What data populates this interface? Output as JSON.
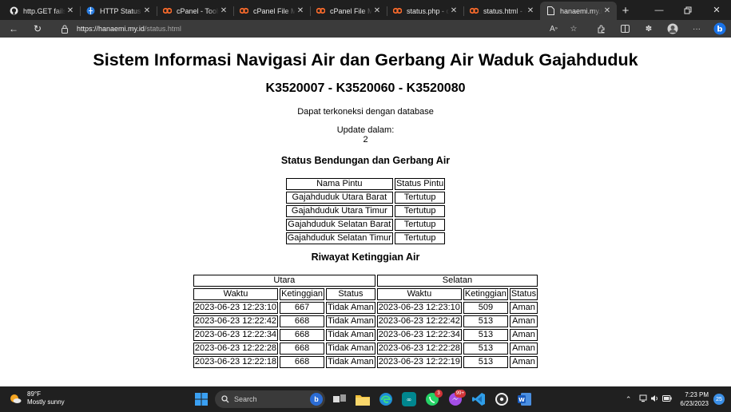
{
  "browser": {
    "tabs": [
      {
        "title": "http.GET fails",
        "icon": "github"
      },
      {
        "title": "HTTP Status C",
        "icon": "globe"
      },
      {
        "title": "cPanel - Tools",
        "icon": "cpanel"
      },
      {
        "title": "cPanel File Ma",
        "icon": "cpanel"
      },
      {
        "title": "cPanel File Ma",
        "icon": "cpanel"
      },
      {
        "title": "status.php - c",
        "icon": "cpanel"
      },
      {
        "title": "status.html - c",
        "icon": "cpanel"
      },
      {
        "title": "hanaemi.my.id",
        "icon": "page",
        "active": true
      }
    ],
    "url_host": "https://hanaemi.my.id",
    "url_path": "/status.html"
  },
  "page": {
    "title": "Sistem Informasi Navigasi Air dan Gerbang Air Waduk Gajahduduk",
    "subtitle": "K3520007 - K3520060 - K3520080",
    "db_status": "Dapat terkoneksi dengan database",
    "update_label": "Update dalam:",
    "update_value": "2",
    "gate_section_title": "Status Bendungan dan Gerbang Air",
    "gate_table": {
      "headers": [
        "Nama Pintu",
        "Status Pintu"
      ],
      "rows": [
        [
          "Gajahduduk Utara Barat",
          "Tertutup"
        ],
        [
          "Gajahduduk Utara Timur",
          "Tertutup"
        ],
        [
          "Gajahduduk Selatan Barat",
          "Tertutup"
        ],
        [
          "Gajahduduk Selatan Timur",
          "Tertutup"
        ]
      ]
    },
    "history_section_title": "Riwayat Ketinggian Air",
    "history_table": {
      "group_headers": [
        "Utara",
        "Selatan"
      ],
      "headers": [
        "Waktu",
        "Ketinggian",
        "Status",
        "Waktu",
        "Ketinggian",
        "Status"
      ],
      "rows": [
        [
          "2023-06-23 12:23:10",
          "667",
          "Tidak Aman",
          "2023-06-23 12:23:10",
          "509",
          "Aman"
        ],
        [
          "2023-06-23 12:22:42",
          "668",
          "Tidak Aman",
          "2023-06-23 12:22:42",
          "513",
          "Aman"
        ],
        [
          "2023-06-23 12:22:34",
          "668",
          "Tidak Aman",
          "2023-06-23 12:22:34",
          "513",
          "Aman"
        ],
        [
          "2023-06-23 12:22:28",
          "668",
          "Tidak Aman",
          "2023-06-23 12:22:28",
          "513",
          "Aman"
        ],
        [
          "2023-06-23 12:22:18",
          "668",
          "Tidak Aman",
          "2023-06-23 12:22:19",
          "513",
          "Aman"
        ]
      ]
    }
  },
  "taskbar": {
    "weather_temp": "89°F",
    "weather_desc": "Mostly sunny",
    "search_placeholder": "Search",
    "time": "7:23 PM",
    "date": "6/23/2023",
    "notification_count": "25",
    "whatsapp_badge": "3",
    "messenger_badge": "99+"
  }
}
